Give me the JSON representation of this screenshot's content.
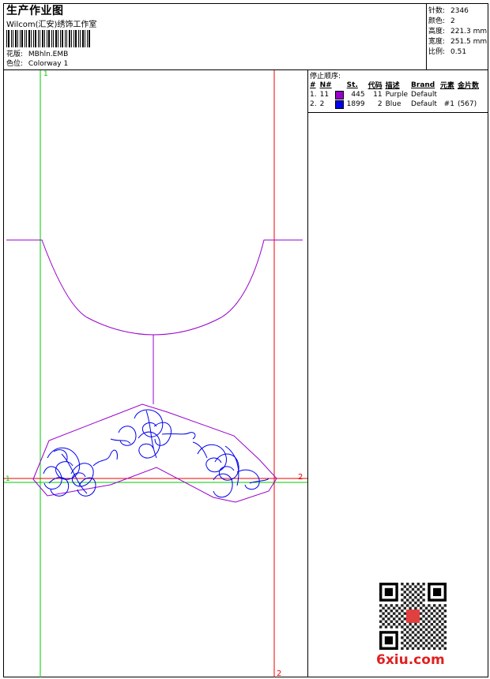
{
  "header": {
    "title": "生产作业图",
    "company": "Wilcom(汇安)绣饰工作室",
    "design_label": "花版:",
    "design_value": "MBhln.EMB",
    "colorway_label": "色位:",
    "colorway_value": "Colorway 1"
  },
  "info": [
    {
      "label": "针数:",
      "value": "2346"
    },
    {
      "label": "颜色:",
      "value": "2"
    },
    {
      "label": "高度:",
      "value": "221.3 mm"
    },
    {
      "label": "宽度:",
      "value": "251.5 mm"
    },
    {
      "label": "比例:",
      "value": "0.51"
    }
  ],
  "stops": {
    "heading": "停止顺序:",
    "columns": [
      "#",
      "N#",
      "St.",
      "代码",
      "描述",
      "Brand",
      "元素",
      "金片数"
    ],
    "rows": [
      {
        "index": "1.",
        "n": "11",
        "color": "#9900cc",
        "st": "445",
        "code": "11",
        "desc": "Purple",
        "brand": "Default",
        "elements": "",
        "sequins": ""
      },
      {
        "index": "2.",
        "n": "2",
        "color": "#0000ee",
        "st": "1899",
        "code": "2",
        "desc": "Blue",
        "brand": "Default",
        "elements": "#1",
        "sequins": "(567)"
      }
    ]
  },
  "markers": {
    "green_top": "1",
    "green_left": "1",
    "red_right": "2",
    "red_bottom": "2"
  },
  "colors": {
    "purple": "#9900cc",
    "blue": "#0000ee",
    "green_guide": "#00cc00",
    "red_guide": "#ee0000"
  },
  "watermark": "6xiu.com"
}
